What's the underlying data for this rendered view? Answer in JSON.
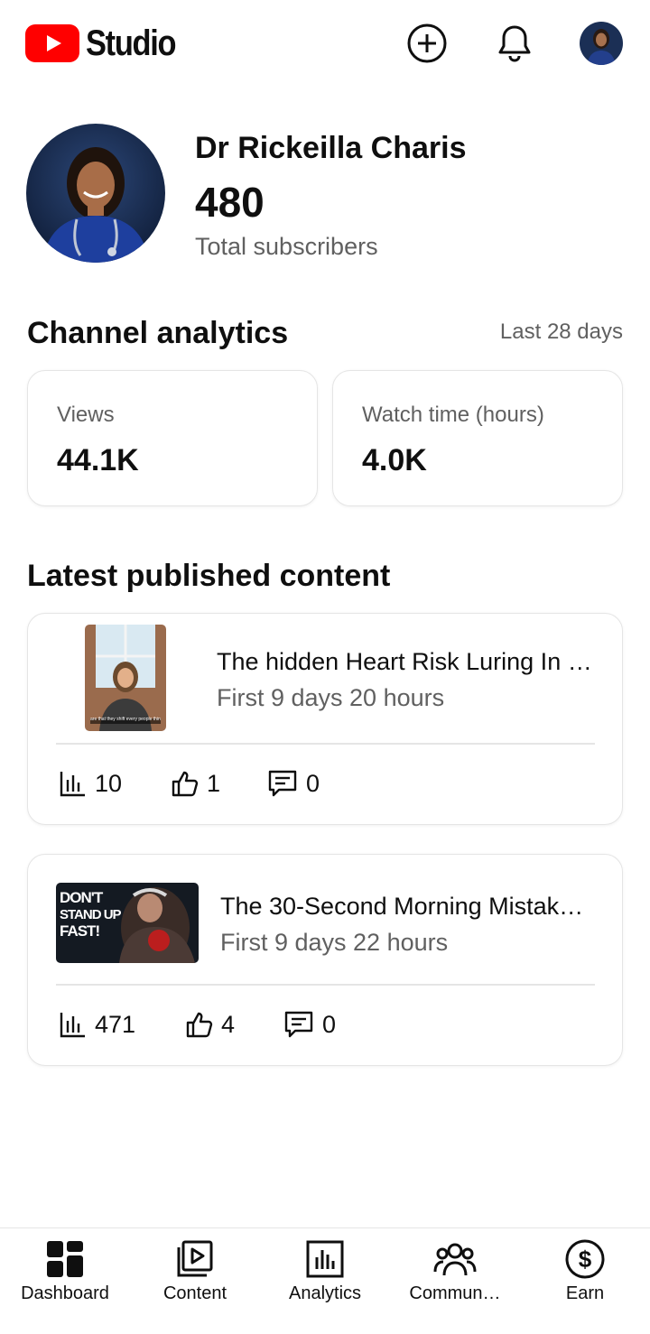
{
  "app": {
    "logo_text": "Studio",
    "accent_color": "#ff0000"
  },
  "header": {
    "icons": [
      "create-icon",
      "notifications-bell-icon",
      "account-avatar"
    ]
  },
  "profile": {
    "name": "Dr Rickeilla Charis",
    "subscriber_count": "480",
    "subscriber_label": "Total subscribers"
  },
  "analytics": {
    "title": "Channel analytics",
    "range": "Last 28 days",
    "cards": [
      {
        "label": "Views",
        "value": "44.1K"
      },
      {
        "label": "Watch time (hours)",
        "value": "4.0K"
      }
    ]
  },
  "latest": {
    "title": "Latest published content",
    "items": [
      {
        "title": "The hidden Heart Risk Luring In …",
        "subtitle": "First 9 days 20 hours",
        "views": "10",
        "likes": "1",
        "comments": "0",
        "thumb_caption": "are that they shift every people think"
      },
      {
        "title": "The 30-Second Morning Mistak…",
        "subtitle": "First 9 days 22 hours",
        "views": "471",
        "likes": "4",
        "comments": "0",
        "thumb_text_1": "DON'T",
        "thumb_text_2": "STAND UP",
        "thumb_text_3": "FAST!"
      }
    ]
  },
  "nav": {
    "items": [
      {
        "label": "Dashboard",
        "icon": "dashboard-icon"
      },
      {
        "label": "Content",
        "icon": "content-icon"
      },
      {
        "label": "Analytics",
        "icon": "analytics-icon"
      },
      {
        "label": "Commun…",
        "icon": "community-icon"
      },
      {
        "label": "Earn",
        "icon": "earn-icon"
      }
    ]
  }
}
